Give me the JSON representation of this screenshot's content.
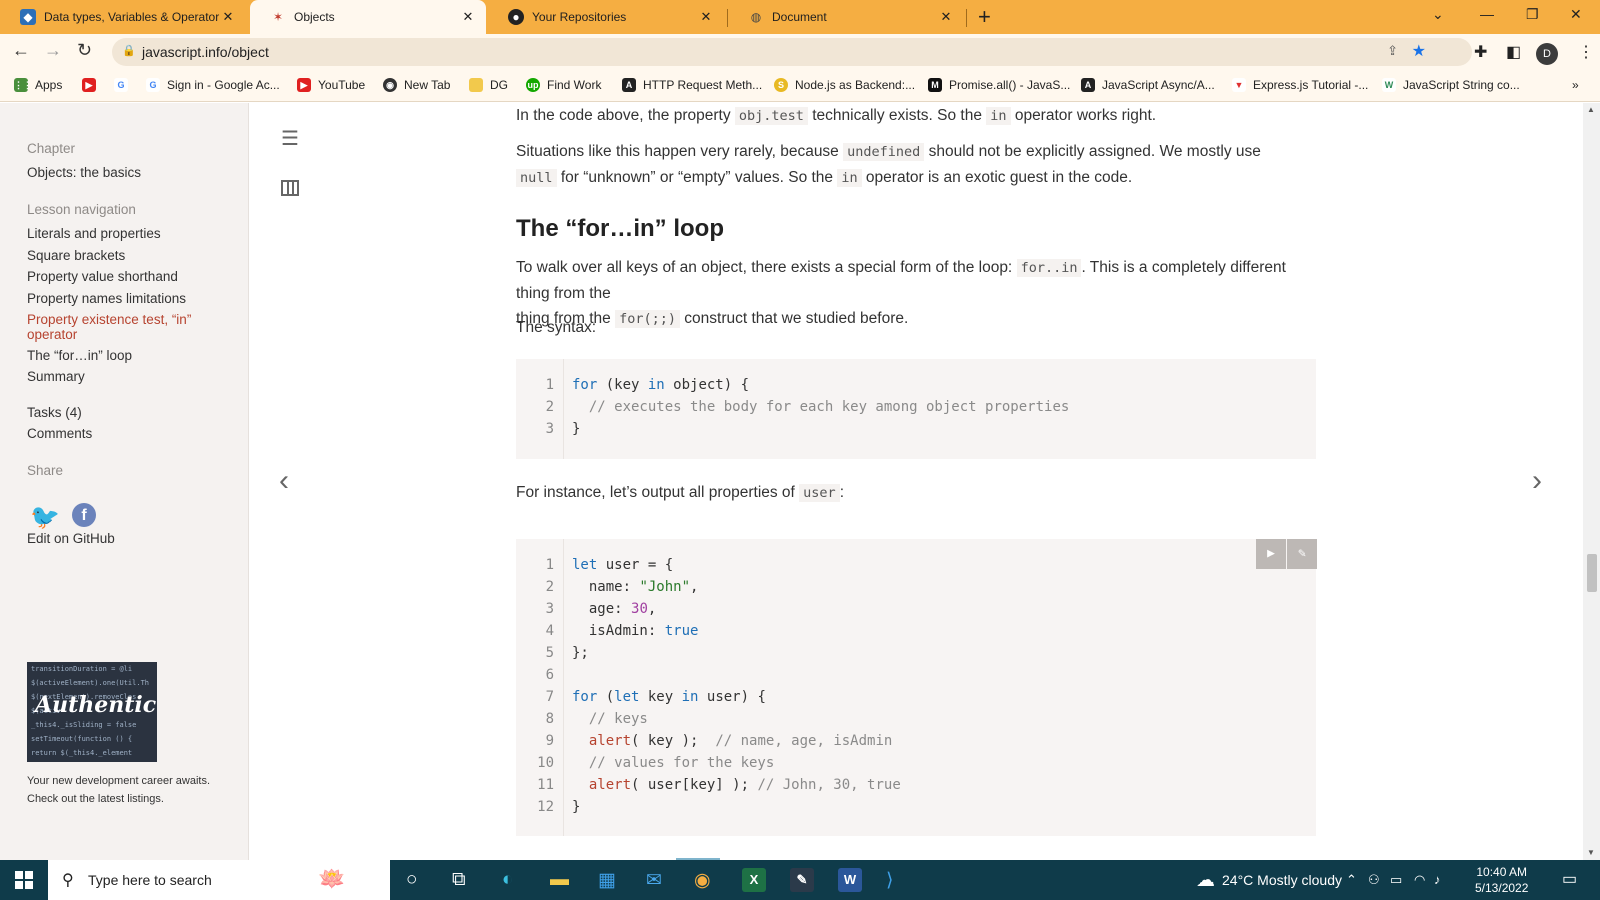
{
  "browser": {
    "tabs": [
      {
        "title": "Data types, Variables & Operator",
        "favicon": "webpack-icon",
        "active": false
      },
      {
        "title": "Objects",
        "favicon": "javascript-info-icon",
        "active": true
      },
      {
        "title": "Your Repositories",
        "favicon": "github-icon",
        "active": false
      },
      {
        "title": "Document",
        "favicon": "globe-icon",
        "active": false
      }
    ],
    "url": "javascript.info/object",
    "profile_initial": "D",
    "bookmarks": [
      {
        "label": "Apps",
        "icon": "apps-grid-icon"
      },
      {
        "label": "",
        "icon": "youtube-icon"
      },
      {
        "label": "",
        "icon": "google-icon"
      },
      {
        "label": "Sign in - Google Ac...",
        "icon": "google-icon"
      },
      {
        "label": "YouTube",
        "icon": "youtube-icon"
      },
      {
        "label": "New Tab",
        "icon": "chrome-icon"
      },
      {
        "label": "DG",
        "icon": "folder-icon"
      },
      {
        "label": "Find Work",
        "icon": "upwork-icon"
      },
      {
        "label": "HTTP Request Meth...",
        "icon": "javascript-info-icon"
      },
      {
        "label": "Node.js as Backend:...",
        "icon": "coin-icon"
      },
      {
        "label": "Promise.all() - JavaS...",
        "icon": "mdn-icon"
      },
      {
        "label": "JavaScript Async/A...",
        "icon": "javascript-info-icon"
      },
      {
        "label": "Express.js Tutorial -...",
        "icon": "vue-icon"
      },
      {
        "label": "JavaScript String co...",
        "icon": "w3schools-icon"
      }
    ]
  },
  "sidebar": {
    "chapter_label": "Chapter",
    "chapter_title": "Objects: the basics",
    "lesson_nav_label": "Lesson navigation",
    "lessons": [
      {
        "label": "Literals and properties"
      },
      {
        "label": "Square brackets"
      },
      {
        "label": "Property value shorthand"
      },
      {
        "label": "Property names limitations"
      },
      {
        "label": "Property existence test, “in” operator"
      },
      {
        "label": "The “for…in” loop"
      },
      {
        "label": "Summary"
      }
    ],
    "tasks": "Tasks (4)",
    "comments": "Comments",
    "share_label": "Share",
    "edit_github": "Edit on GitHub",
    "ad_logo": "Authentic",
    "ad_code": [
      "transitionDuration = @li",
      "$(activeElement).one(Util.Th",
      "$(nextElement).removeClas",
      "$(activ",
      "_this4._isSliding = false",
      "setTimeout(function () {",
      "  return $(_this4._element"
    ],
    "ad_text": "Your new development career awaits. Check out the latest listings."
  },
  "content": {
    "p1": {
      "a": "In the code above, the property ",
      "c1": "obj.test",
      "b": " technically exists. So the ",
      "c2": "in",
      "d": " operator works right."
    },
    "p2": {
      "a": "Situations like this happen very rarely, because ",
      "c1": "undefined",
      "b": " should not be explicitly assigned. We mostly use ",
      "c2": "null",
      "d": " for “unknown” or “empty” values. So the ",
      "c3": "in",
      "e": " operator is an exotic guest in the code."
    },
    "heading": "The “for…in” loop",
    "p3": {
      "a": "To walk over all keys of an object, there exists a special form of the loop: ",
      "c1": "for..in",
      "b": ". This is a completely different thing from the ",
      "c2": "for(;;)",
      "d": " construct that we studied before."
    },
    "p4": "The syntax:",
    "p5": {
      "a": "For instance, let’s output all properties of ",
      "c1": "user",
      "b": ":"
    },
    "code1": [
      {
        "n": "1",
        "src": "for (key in object) {"
      },
      {
        "n": "2",
        "src": "  // executes the body for each key among object properties"
      },
      {
        "n": "3",
        "src": "}"
      }
    ],
    "code2": [
      {
        "n": "1",
        "src": "let user = {"
      },
      {
        "n": "2",
        "src": "  name: \"John\","
      },
      {
        "n": "3",
        "src": "  age: 30,"
      },
      {
        "n": "4",
        "src": "  isAdmin: true"
      },
      {
        "n": "5",
        "src": "};"
      },
      {
        "n": "6",
        "src": ""
      },
      {
        "n": "7",
        "src": "for (let key in user) {"
      },
      {
        "n": "8",
        "src": "  // keys"
      },
      {
        "n": "9",
        "src": "  alert( key );  // name, age, isAdmin"
      },
      {
        "n": "10",
        "src": "  // values for the keys"
      },
      {
        "n": "11",
        "src": "  alert( user[key] ); // John, 30, true"
      },
      {
        "n": "12",
        "src": "}"
      }
    ]
  },
  "taskbar": {
    "search_placeholder": "Type here to search",
    "weather": "24°C  Mostly cloudy",
    "time": "10:40 AM",
    "date": "5/13/2022"
  },
  "colors": {
    "chrome_accent": "#f5ae42",
    "link_current": "#b6432f",
    "taskbar": "#0f3b4a"
  }
}
